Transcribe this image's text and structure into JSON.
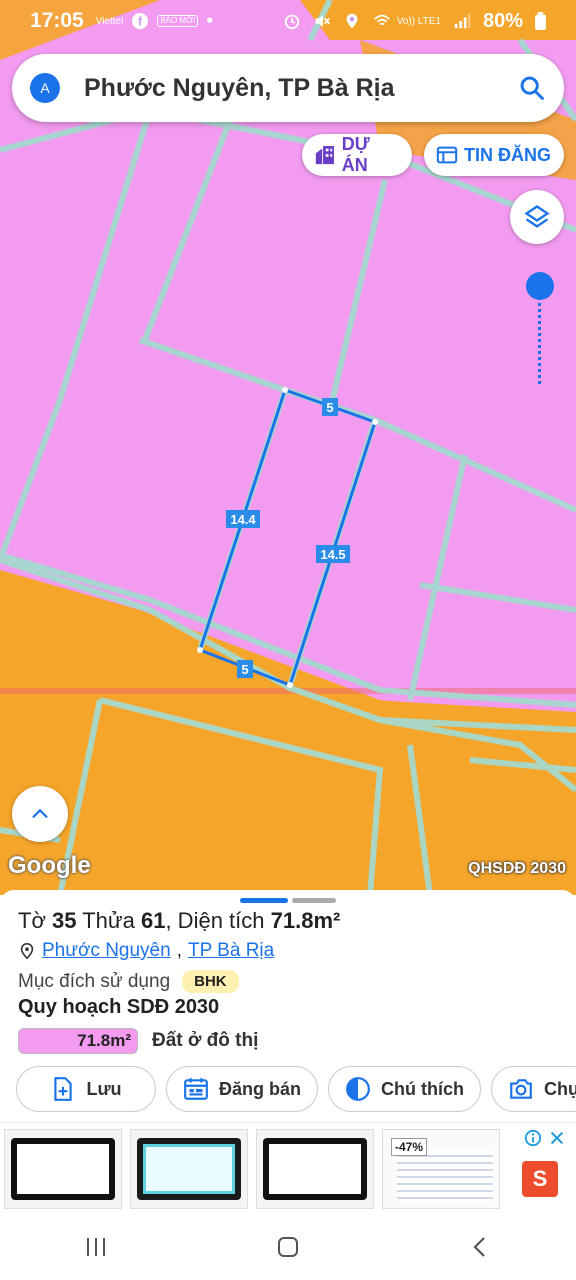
{
  "status_bar": {
    "time": "17:05",
    "carrier_small": "Viettel",
    "baomoi": "BÁO MỚI",
    "lte": "Vo)) LTE1",
    "battery": "80%"
  },
  "search": {
    "avatar_letter": "A",
    "query": "Phước Nguyên, TP Bà Rịa"
  },
  "pills": {
    "project": "DỰ ÁN",
    "listing": "TIN ĐĂNG"
  },
  "map": {
    "edge_top": "5",
    "edge_left": "14.4",
    "edge_right": "14.5",
    "edge_bottom": "5",
    "google": "Google",
    "layer_label": "QHSDĐ 2030"
  },
  "sheet": {
    "sheet_prefix": "Tờ",
    "sheet_no": "35",
    "parcel_prefix": "Thửa",
    "parcel_no": "61",
    "area_prefix": ", Diện tích",
    "area_value": "71.8m²",
    "ward": "Phước Nguyên",
    "city": "TP Bà Rịa",
    "purpose_label": "Mục đích sử dụng",
    "purpose_code": "BHK",
    "plan_title": "Quy hoạch SDĐ 2030",
    "plan_area": "71.8m²",
    "plan_use": "Đất ở đô thị",
    "actions": {
      "save": "Lưu",
      "sell": "Đăng bán",
      "note": "Chú thích",
      "photo": "Chụ"
    }
  },
  "ads": {
    "discount": "-47%"
  },
  "colors": {
    "accent": "#1a73e8",
    "residential": "#f29bf0",
    "road": "#f5a52a",
    "parcel_line": "#a6d9cf"
  }
}
